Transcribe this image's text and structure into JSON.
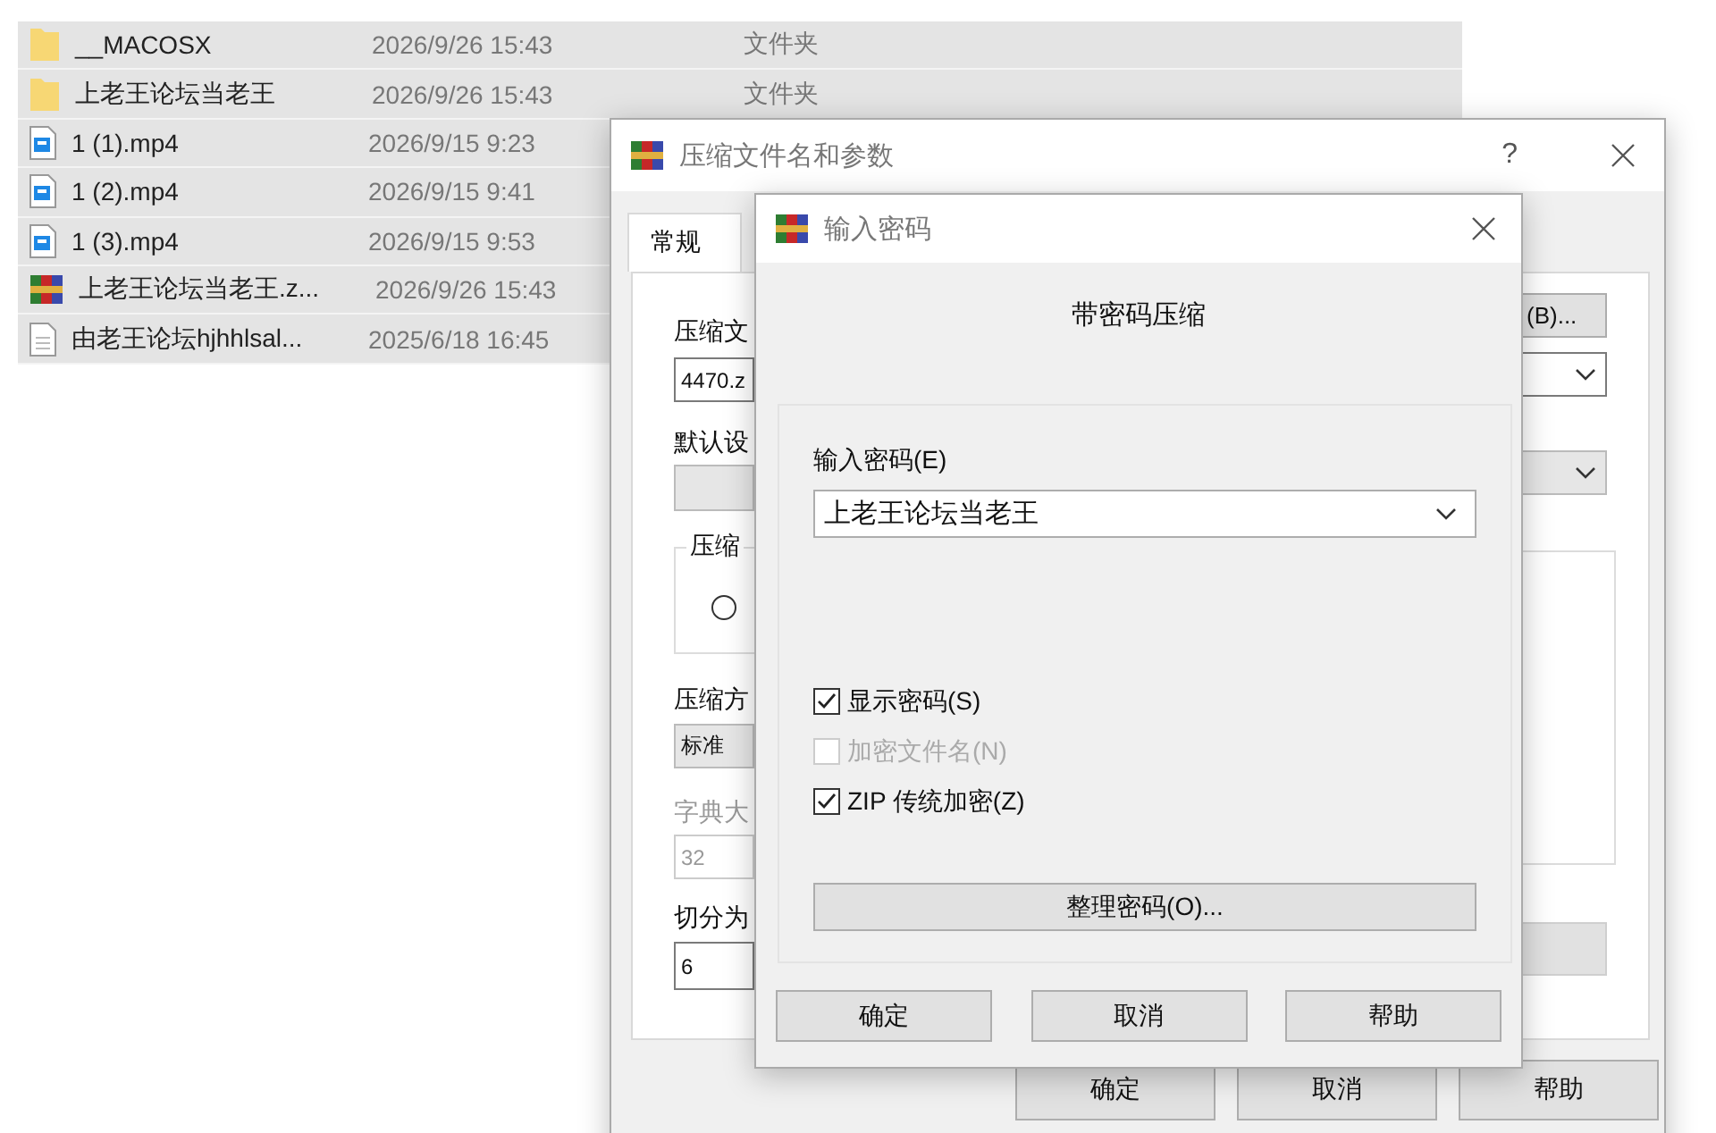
{
  "files": [
    {
      "kind": "folder",
      "name": "__MACOSX",
      "date": "2026/9/26 15:43",
      "type": "文件夹"
    },
    {
      "kind": "folder",
      "name": "上老王论坛当老王",
      "date": "2026/9/26 15:43",
      "type": "文件夹"
    },
    {
      "kind": "video",
      "name": "1 (1).mp4",
      "date": "2026/9/15 9:23"
    },
    {
      "kind": "video",
      "name": "1 (2).mp4",
      "date": "2026/9/15 9:41"
    },
    {
      "kind": "video",
      "name": "1 (3).mp4",
      "date": "2026/9/15 9:53"
    },
    {
      "kind": "archive",
      "name": "上老王论坛当老王.z...",
      "date": "2026/9/26 15:43"
    },
    {
      "kind": "text",
      "name": "由老王论坛hjhhlsal...",
      "date": "2025/6/18 16:45"
    }
  ],
  "archive_dialog": {
    "title": "压缩文件名和参数",
    "help": "?",
    "tabs": [
      {
        "label": "常规",
        "selected": true
      }
    ],
    "left": {
      "name_label": "压缩文",
      "name_value": "4470.z",
      "profile_label": "默认设",
      "group_label": "压缩",
      "radio": {
        "selected": false
      },
      "method_label": "压缩方",
      "method_value": "标准",
      "dict_label": "字典大",
      "dict_value": "32",
      "split_label": "切分为",
      "split_value": "6"
    },
    "browse_button": "(B)...",
    "buttons": [
      "确定",
      "取消",
      "帮助"
    ]
  },
  "password_dialog": {
    "title": "输入密码",
    "heading": "带密码压缩",
    "field_label": "输入密码(E)",
    "password": "上老王论坛当老王",
    "options": [
      {
        "label": "显示密码(S)",
        "checked": true,
        "disabled": false
      },
      {
        "label": "加密文件名(N)",
        "checked": false,
        "disabled": true
      },
      {
        "label": "ZIP 传统加密(Z)",
        "checked": true,
        "disabled": false
      }
    ],
    "organize_button": "整理密码(O)...",
    "buttons": [
      "确定",
      "取消",
      "帮助"
    ]
  }
}
